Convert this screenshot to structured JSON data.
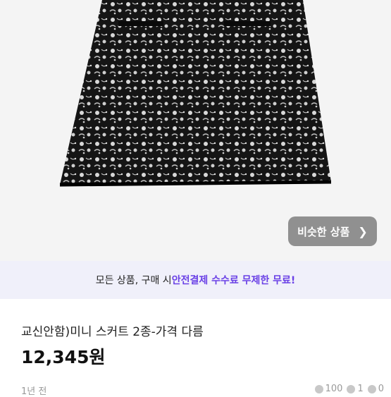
{
  "photo": {
    "alt": ""
  },
  "similar_button": {
    "label": "비슷한 상품",
    "icon": "chevron-right-icon"
  },
  "promo": {
    "prefix": "모든 상품, 구매 시 ",
    "highlight": "안전결제 수수료 무제한 무료!"
  },
  "product": {
    "title": "교신안함)미니 스커트 2종-가격 다름",
    "price": "12,345원"
  },
  "meta": {
    "time": "1년 전",
    "views": "100",
    "likes": "1",
    "chats": "0"
  },
  "colors": {
    "accent": "#6a40e6",
    "promo_bg": "#f0f0fa"
  }
}
